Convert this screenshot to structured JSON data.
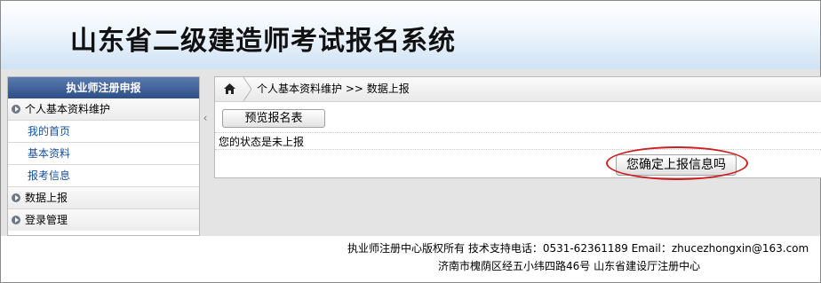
{
  "header": {
    "title": "山东省二级建造师考试报名系统"
  },
  "sidebar": {
    "title": "执业师注册申报",
    "groups": [
      {
        "label": "个人基本资料维护",
        "items": [
          "我的首页",
          "基本资料",
          "报考信息"
        ]
      },
      {
        "label": "数据上报"
      },
      {
        "label": "登录管理"
      }
    ]
  },
  "sidebar_toggle": {
    "glyph": "‹"
  },
  "breadcrumb": {
    "text": "个人基本资料维护 >> 数据上报"
  },
  "main": {
    "preview_button": "预览报名表",
    "status_text": "您的状态是未上报",
    "confirm_button": "您确定上报信息吗"
  },
  "footer": {
    "line1": "执业师注册中心版权所有 技术支持电话：0531-62361189 Email：zhucezhongxin@163.com",
    "line2": "济南市槐荫区经五小纬四路46号 山东省建设厅注册中心"
  },
  "icons": {
    "home": "home-icon",
    "menu_bullet": "arrow-circle-icon"
  },
  "colors": {
    "sidebar_header": "#2e4f86",
    "link": "#1a4f98",
    "highlight": "#cc1f1f"
  }
}
